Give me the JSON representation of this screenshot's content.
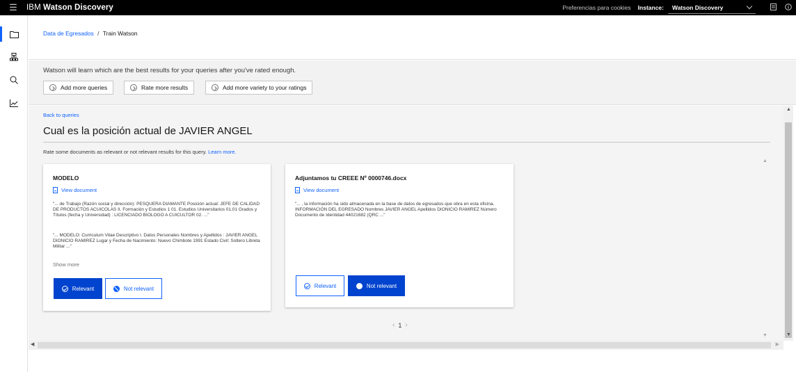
{
  "app": {
    "menu_icon": "hamburger-icon",
    "brand_prefix": "IBM",
    "brand_name": "Watson Discovery",
    "cookies_label": "Preferencias para cookies",
    "instance_label": "Instance:",
    "instance_value": "Watson Discovery",
    "accent_color": "#0f62fe",
    "primary_button_color": "#0043ce"
  },
  "nav": {
    "items": [
      {
        "icon": "folder-icon"
      },
      {
        "icon": "structure-icon"
      },
      {
        "icon": "search-icon"
      },
      {
        "icon": "analytics-icon"
      }
    ]
  },
  "breadcrumb": {
    "parent": "Data de Egresados",
    "separator": "/",
    "current": "Train Watson"
  },
  "banner": {
    "message": "Watson will learn which are the best results for your queries after you've rated enough.",
    "actions": [
      "Add more queries",
      "Rate more results",
      "Add more variety to your ratings"
    ]
  },
  "query": {
    "back_label": "Back to queries",
    "title": "Cual es la posición actual de JAVIER ANGEL",
    "instructions": "Rate some documents as relevant or not relevant results for this query.",
    "learn_more": "Learn more."
  },
  "results": [
    {
      "title": "MODELO",
      "view_label": "View document",
      "excerpts": [
        "\"... de Trabajo (Razón social y dirección): PESQUERA DIAMANTE Posición actual: JEFE DE CALIDAD DE PRODUCTOS ACUICOLAS II. Formación y Estudios 1 01. Estudios Universitarios 01.01 Grados y Títulos (fecha y Universidad) : LICENCIADO BIOLOGO A CUICULTOR 02. ...\"",
        "\"... MODELO: Curriculum Vitae Descriptivo I. Datos Personales Nombres y Apellidos : JAVIER ANGEL DIONICIO RAMIREZ Lugar y Fecha de Nacimiento: Nuevo Chimbote 1991 Estado Civil: Soltero Libreta Militar ...\""
      ],
      "show_more": "Show more",
      "relevant_label": "Relevant",
      "not_relevant_label": "Not relevant",
      "rating": "relevant"
    },
    {
      "title": "Adjuntamos tu CREEE Nº 0000746.docx",
      "view_label": "View document",
      "excerpts": [
        "\"... , la información ha sido almacenada en la base de datos de egresados que obra en esta oficina. INFORMACIÓN DEL EGRESADO Nombres JAVIER ANGEL Apellidos DIONICIO RAMIREZ Número Documento de Identidad 44021682 (QRC ...\""
      ],
      "relevant_label": "Relevant",
      "not_relevant_label": "Not relevant",
      "rating": "not relevant"
    }
  ],
  "pagination": {
    "page": "1"
  }
}
